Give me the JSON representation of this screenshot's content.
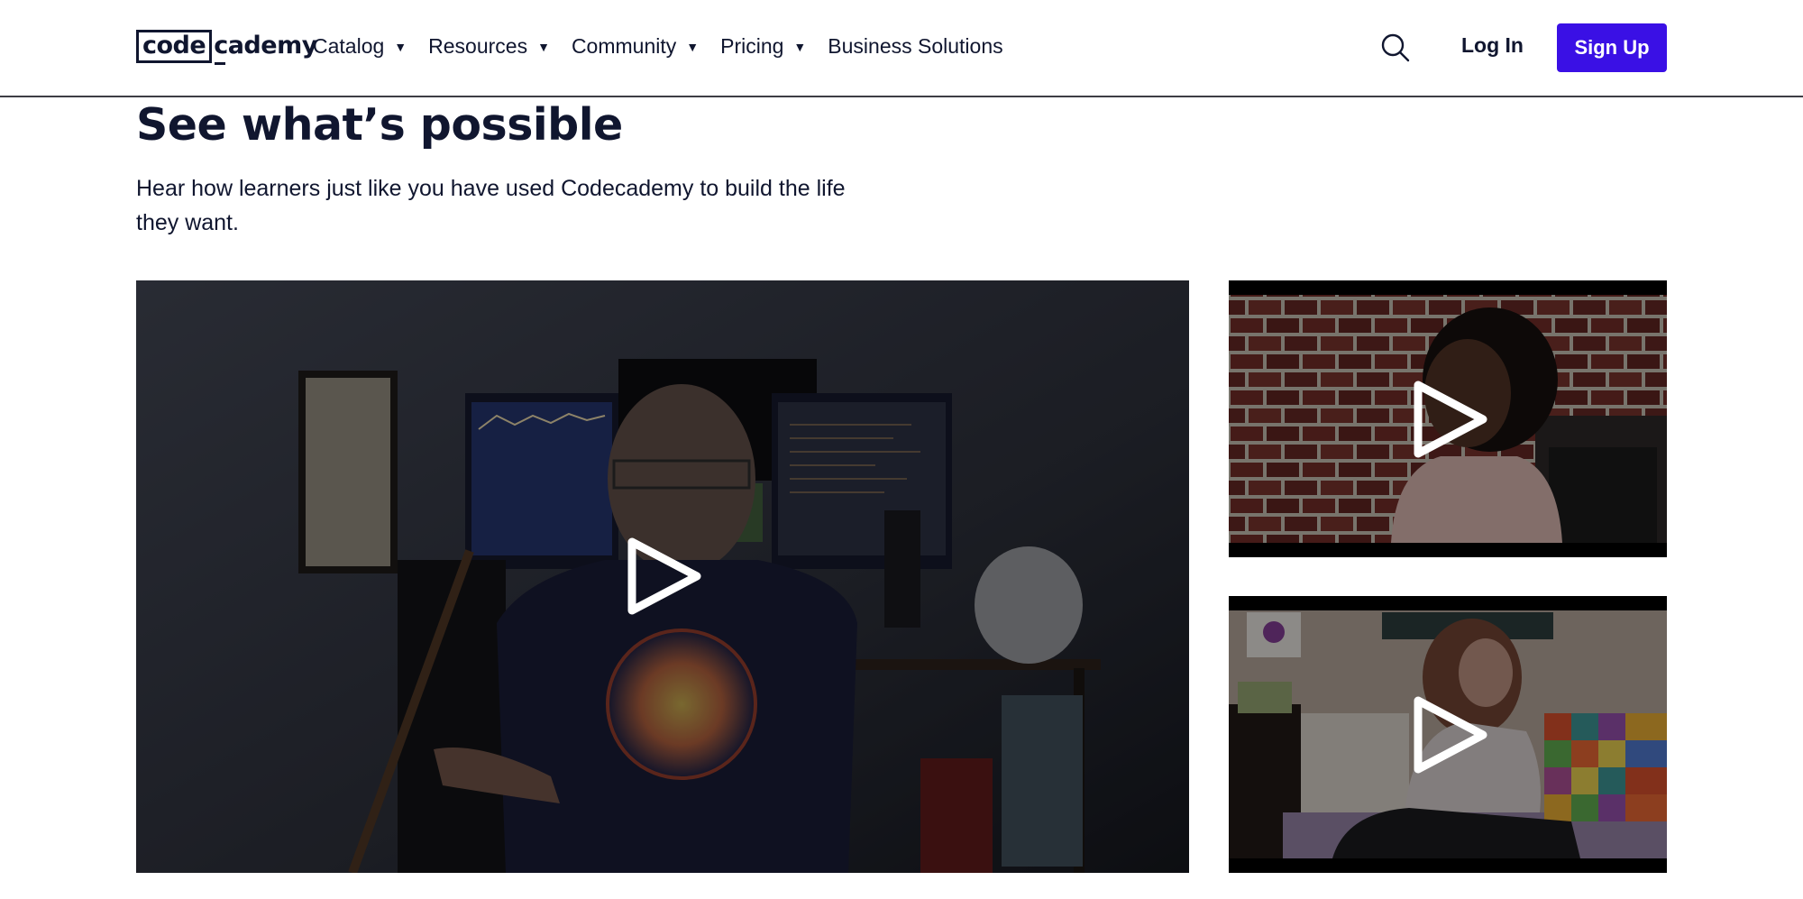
{
  "header": {
    "logo": {
      "boxed_text": "code",
      "rest_text": "cademy"
    },
    "nav": [
      {
        "label": "Catalog",
        "has_dropdown": true
      },
      {
        "label": "Resources",
        "has_dropdown": true
      },
      {
        "label": "Community",
        "has_dropdown": true
      },
      {
        "label": "Pricing",
        "has_dropdown": true
      },
      {
        "label": "Business Solutions",
        "has_dropdown": false
      }
    ],
    "caret_glyph": "▼",
    "search_icon": "search-icon",
    "login_label": "Log In",
    "signup_label": "Sign Up"
  },
  "section": {
    "title": "See what’s possible",
    "description": "Hear how learners just like you have used Codecademy to build the life they want."
  },
  "videos": [
    {
      "name": "main-video",
      "description": "Learner in home office with monitors",
      "play_icon": "play-icon"
    },
    {
      "name": "thumbnail-video-1",
      "description": "Learner smiling in front of brick wall",
      "play_icon": "play-icon"
    },
    {
      "name": "thumbnail-video-2",
      "description": "Learner sitting on colorful crocheted couch",
      "play_icon": "play-icon"
    }
  ],
  "colors": {
    "text_primary": "#10162F",
    "brand_primary": "#3A10E5",
    "header_border": "#3d3d45",
    "background": "#ffffff"
  }
}
